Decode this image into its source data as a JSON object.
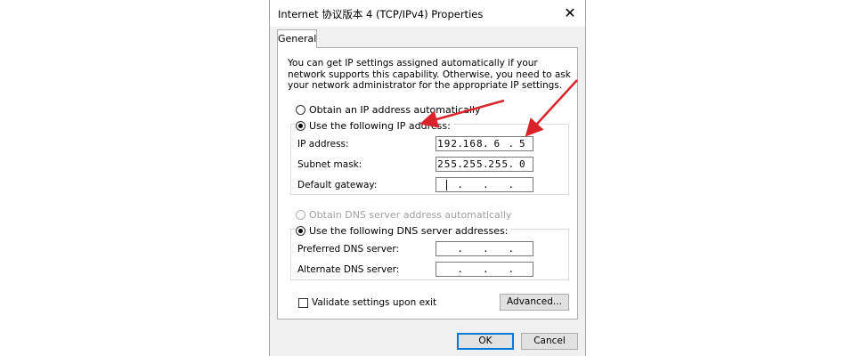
{
  "window": {
    "title": "Internet 协议版本 4 (TCP/IPv4) Properties",
    "close_glyph": "✕"
  },
  "tabs": [
    {
      "label": "General"
    }
  ],
  "intro_text": "You can get IP settings assigned automatically if your network supports this capability. Otherwise, you need to ask your network administrator for the appropriate IP settings.",
  "ip_section": {
    "auto_label": "Obtain an IP address automatically",
    "auto_selected": false,
    "manual_label": "Use the following IP address:",
    "manual_selected": true,
    "fields": [
      {
        "label": "IP address:",
        "octets": [
          "192",
          "168",
          "6",
          "5"
        ]
      },
      {
        "label": "Subnet mask:",
        "octets": [
          "255",
          "255",
          "255",
          "0"
        ]
      },
      {
        "label": "Default gateway:",
        "octets": [
          "",
          "",
          "",
          ""
        ]
      }
    ]
  },
  "dns_section": {
    "auto_label": "Obtain DNS server address automatically",
    "auto_selected": false,
    "auto_disabled": true,
    "manual_label": "Use the following DNS server addresses:",
    "manual_selected": true,
    "fields": [
      {
        "label": "Preferred DNS server:",
        "octets": [
          "",
          "",
          "",
          ""
        ]
      },
      {
        "label": "Alternate DNS server:",
        "octets": [
          "",
          "",
          "",
          ""
        ]
      }
    ]
  },
  "validate": {
    "label": "Validate settings upon exit",
    "checked": false
  },
  "buttons": {
    "advanced": "Advanced...",
    "ok": "OK",
    "cancel": "Cancel"
  },
  "colors": {
    "accent": "#0078d7",
    "annotation_arrow": "#d9222a"
  }
}
